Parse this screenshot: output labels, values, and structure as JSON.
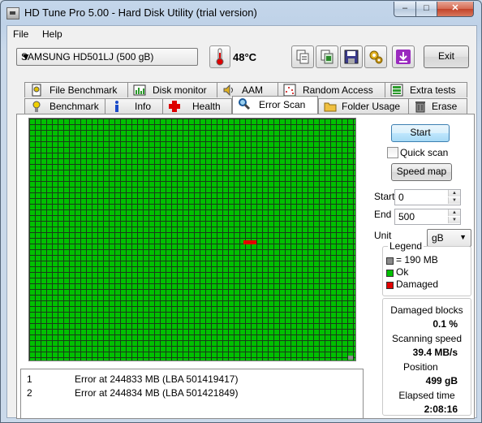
{
  "window": {
    "title": "HD Tune Pro 5.00 - Hard Disk Utility (trial version)",
    "minimize": "–",
    "maximize": "□",
    "close": "✕"
  },
  "menu": {
    "file": "File",
    "help": "Help"
  },
  "toolbar": {
    "drive": "SAMSUNG HD501LJ (500 gB)",
    "temperature": "48°C",
    "exit_label": "Exit",
    "icons": [
      "copy-text-icon",
      "copy-screenshot-icon",
      "save-icon",
      "options-icon",
      "download-icon"
    ]
  },
  "tabs_top": [
    "File Benchmark",
    "Disk monitor",
    "AAM",
    "Random Access",
    "Extra tests"
  ],
  "tabs_bottom": [
    "Benchmark",
    "Info",
    "Health",
    "Error Scan",
    "Folder Usage",
    "Erase"
  ],
  "active_tab": "Error Scan",
  "errors": [
    {
      "num": "1",
      "text": "Error at 244833 MB (LBA 501419417)"
    },
    {
      "num": "2",
      "text": "Error at 244834 MB (LBA 501421849)"
    }
  ],
  "controls": {
    "start_label": "Start",
    "quick_scan_label": "Quick scan",
    "quick_scan_checked": false,
    "speed_map_label": "Speed map",
    "start_field_label": "Start",
    "start_value": "0",
    "end_field_label": "End",
    "end_value": "500",
    "unit_label": "Unit",
    "unit_value": "gB"
  },
  "legend": {
    "title": "Legend",
    "block": "= 190 MB",
    "ok": "Ok",
    "damaged": "Damaged",
    "colors": {
      "block": "#8a8a8a",
      "ok": "#00c000",
      "damaged": "#e20000"
    }
  },
  "stats": {
    "damaged_blocks_label": "Damaged blocks",
    "damaged_blocks_value": "0.1 %",
    "scanning_speed_label": "Scanning speed",
    "scanning_speed_value": "39.4 MB/s",
    "position_label": "Position",
    "position_value": "499 gB",
    "elapsed_label": "Elapsed time",
    "elapsed_value": "2:08:16"
  }
}
